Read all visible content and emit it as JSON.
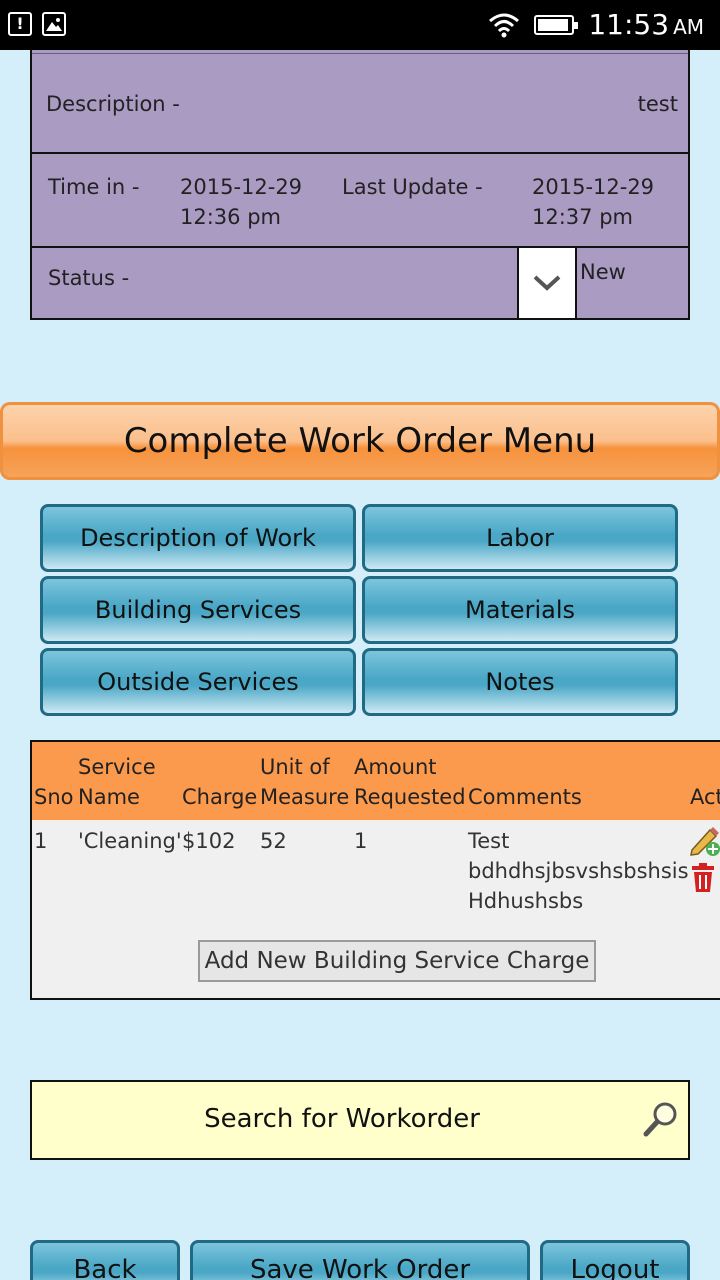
{
  "status_bar": {
    "time": "11:53",
    "ampm": "AM"
  },
  "details": {
    "description_label": "Description -",
    "description_value": "test",
    "time_in_label": "Time in -",
    "time_in_date": "2015-12-29",
    "time_in_time": "12:36 pm",
    "last_update_label": "Last Update -",
    "last_update_date": "2015-12-29",
    "last_update_time": "12:37 pm",
    "status_label": "Status -",
    "status_value": "New"
  },
  "menu": {
    "title": "Complete Work Order Menu",
    "buttons": {
      "description_of_work": "Description of Work",
      "labor": "Labor",
      "building_services": "Building Services",
      "materials": "Materials",
      "outside_services": "Outside Services",
      "notes": "Notes"
    }
  },
  "services_table": {
    "headers": {
      "sno": "Sno",
      "service_line1": "Service",
      "service_line2": "Name",
      "charge": "Charge",
      "unit_line1": "Unit of",
      "unit_line2": "Measure",
      "amount_line1": "Amount",
      "amount_line2": "Requested",
      "comments": "Comments",
      "action": "Act"
    },
    "rows": [
      {
        "sno": "1",
        "service_name": "'Cleaning'",
        "charge": "$102",
        "unit": "52",
        "amount": "1",
        "comment_line1": "Test",
        "comment_line2": "bdhdhsjbsvshsbshsis",
        "comment_line3": "Hdhushsbs"
      }
    ],
    "add_button": "Add New Building Service Charge"
  },
  "search": {
    "label": "Search for Workorder"
  },
  "footer": {
    "back": "Back",
    "save": "Save Work Order",
    "logout": "Logout"
  }
}
